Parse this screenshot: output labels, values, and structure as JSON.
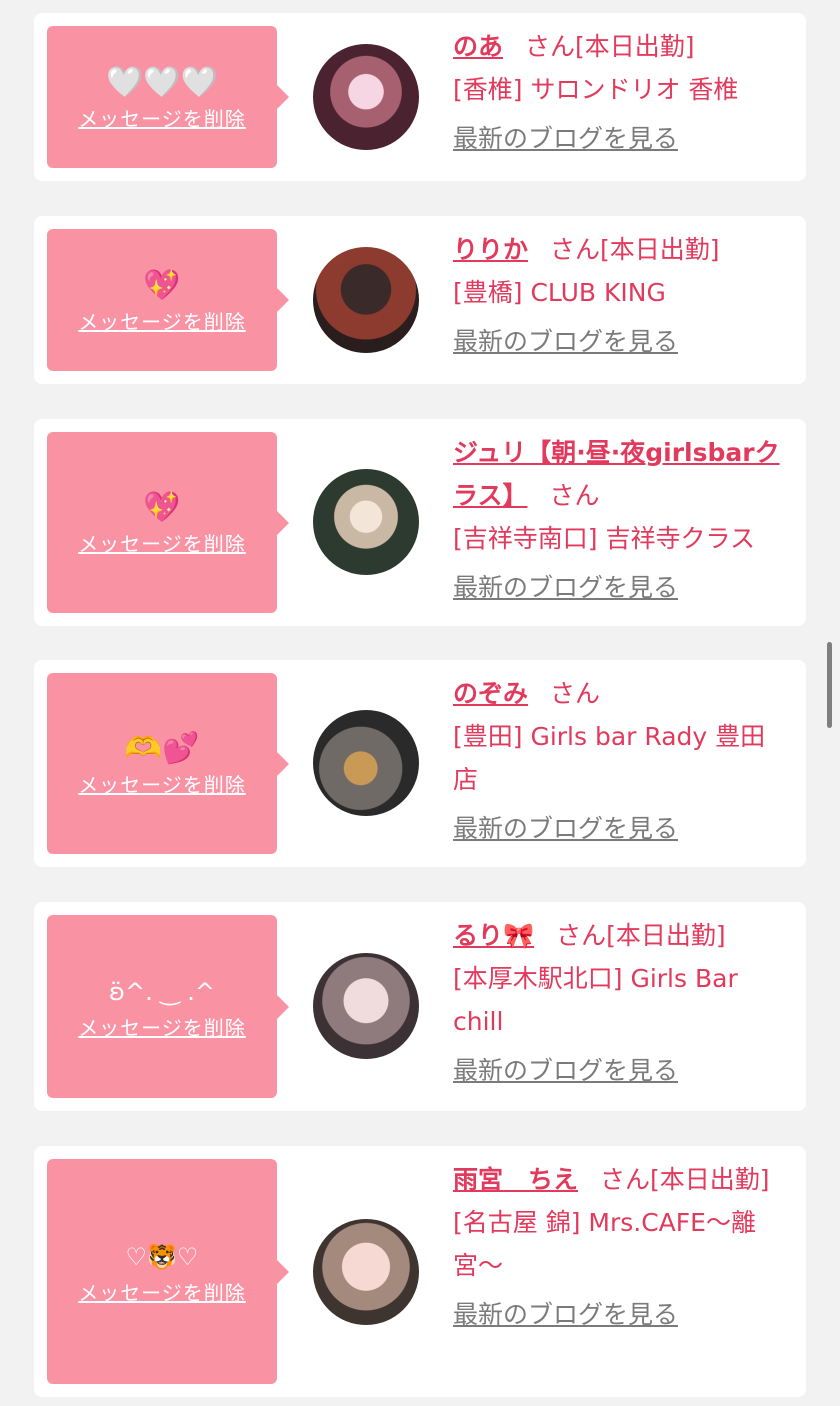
{
  "delete_label": "メッセージを削除",
  "blog_label": "最新のブログを見る",
  "san": "さん",
  "colors": {
    "accent": "#e23a5c",
    "bubble": "#f993a4",
    "link_gray": "#7b7b7b",
    "background": "#f2f2f2"
  },
  "messages": [
    {
      "emoji": "🤍🤍🤍",
      "name": "のあ",
      "status": "[本日出勤]",
      "shop": "[香椎] サロンドリオ 香椎"
    },
    {
      "emoji": "💖",
      "name": "りりか",
      "status": "[本日出勤]",
      "shop": "[豊橋] CLUB KING"
    },
    {
      "emoji": "💖",
      "name": "ジュリ【朝·昼·夜girlsbarクラス】",
      "status": "",
      "shop": "[吉祥寺南口] 吉祥寺クラス"
    },
    {
      "emoji": "🫶💕",
      "name": "のぞみ",
      "status": "",
      "shop": "[豊田] Girls bar Rady 豊田店"
    },
    {
      "emoji": "ʚ̈^. ‿ .^",
      "name": "るり🎀",
      "status": "[本日出勤]",
      "shop": "[本厚木駅北口] Girls Bar chill"
    },
    {
      "emoji": "♡🐯♡",
      "name": "雨宮　ちえ",
      "status": "[本日出勤]",
      "shop": "[名古屋 錦] Mrs.CAFE〜離宮〜"
    }
  ]
}
